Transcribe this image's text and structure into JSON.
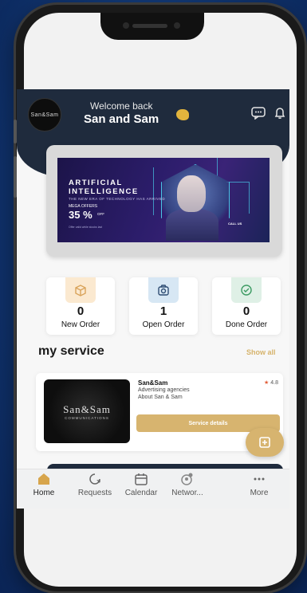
{
  "header": {
    "logo_text": "San&Sam",
    "welcome": "Welcome back",
    "username": "San and Sam",
    "icons": [
      "chat-icon",
      "bell-icon"
    ]
  },
  "banner": {
    "line1": "ARTIFICIAL",
    "line2": "INTELLIGENCE",
    "line3": "THE NEW ERA OF TECHNOLOGY HAS ARRIVED",
    "offer_label": "MEGA OFFERS",
    "offer_value": "35 %",
    "offer_suffix": "OFF",
    "note": "Offer valid while stocks last",
    "call": "CALL US"
  },
  "stats": [
    {
      "icon": "package-icon",
      "value": "0",
      "label": "New Order",
      "color": "#fbe9d0"
    },
    {
      "icon": "folder-icon",
      "value": "1",
      "label": "Open Order",
      "color": "#d7e7f4"
    },
    {
      "icon": "check-circle-icon",
      "value": "0",
      "label": "Done Order",
      "color": "#dff0e6"
    }
  ],
  "service_section": {
    "title": "my service",
    "show_all": "Show all"
  },
  "service_card": {
    "image_brand": "San&Sam",
    "image_sub": "COMMUNICATIONS",
    "name": "San&Sam",
    "category": "Advertising agencies",
    "about": "About San & Sam",
    "rating": "4.8",
    "button": "Service details"
  },
  "fab": {
    "icon": "plus-icon",
    "label": "+"
  },
  "nav": [
    {
      "icon": "home-icon",
      "label": "Home",
      "active": true
    },
    {
      "icon": "requests-icon",
      "label": "Requests"
    },
    {
      "icon": "calendar-icon",
      "label": "Calendar"
    },
    {
      "icon": "network-icon",
      "label": "Networ..."
    },
    {
      "icon": "more-icon",
      "label": "More"
    }
  ],
  "colors": {
    "header_bg": "#1f2b3d",
    "accent_gold": "#d7b46f",
    "background": "#123a78"
  }
}
